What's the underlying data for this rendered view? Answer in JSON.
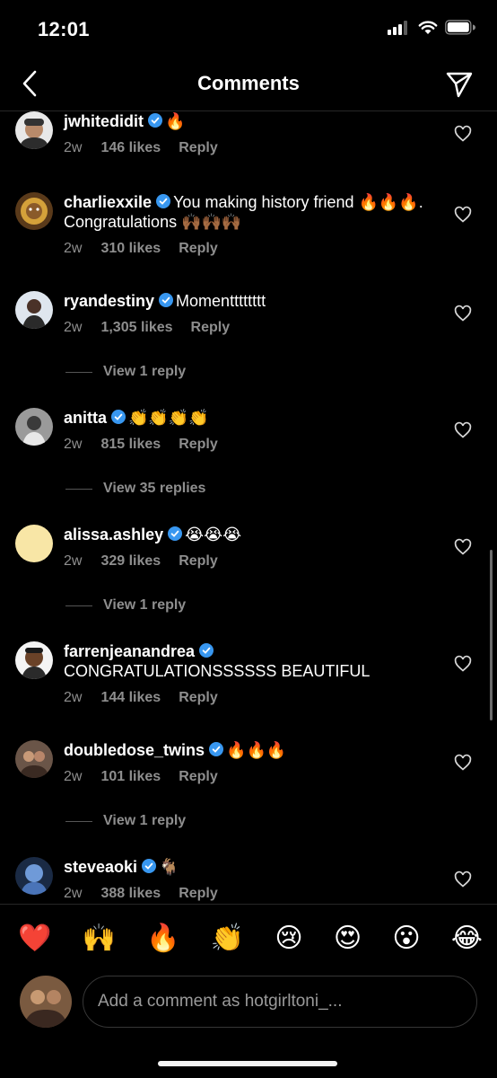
{
  "status": {
    "time": "12:01"
  },
  "nav": {
    "title": "Comments",
    "back_icon": "chevron-left-icon",
    "share_icon": "paper-plane-icon"
  },
  "comments": [
    {
      "username": "jwhitedidit",
      "verified": true,
      "text": "🔥",
      "time": "2w",
      "likes": "146 likes",
      "reply": "Reply"
    },
    {
      "username": "charliexxile",
      "verified": true,
      "text": "You making history friend 🔥🔥🔥. Congratulations 🙌🏾🙌🏾🙌🏾",
      "time": "2w",
      "likes": "310 likes",
      "reply": "Reply"
    },
    {
      "username": "ryandestiny",
      "verified": true,
      "text": "Momentttttttt",
      "time": "2w",
      "likes": "1,305 likes",
      "reply": "Reply",
      "view_replies": "View 1 reply"
    },
    {
      "username": "anitta",
      "verified": true,
      "text": "👏👏👏👏",
      "time": "2w",
      "likes": "815 likes",
      "reply": "Reply",
      "view_replies": "View 35 replies"
    },
    {
      "username": "alissa.ashley",
      "verified": true,
      "text": "😭😭😭",
      "time": "2w",
      "likes": "329 likes",
      "reply": "Reply",
      "view_replies": "View 1 reply"
    },
    {
      "username": "farrenjeanandrea",
      "verified": true,
      "text": "CONGRATULATIONSSSSSS BEAUTIFUL",
      "time": "2w",
      "likes": "144 likes",
      "reply": "Reply"
    },
    {
      "username": "doubledose_twins",
      "verified": true,
      "text": "🔥🔥🔥",
      "time": "2w",
      "likes": "101 likes",
      "reply": "Reply",
      "view_replies": "View 1 reply"
    },
    {
      "username": "steveaoki",
      "verified": true,
      "text": "🐐",
      "time": "2w",
      "likes": "388 likes",
      "reply": "Reply"
    }
  ],
  "reactions": [
    "❤️",
    "🙌",
    "🔥",
    "👏",
    "😢",
    "😍",
    "😮",
    "😂"
  ],
  "composer": {
    "placeholder": "Add a comment as hotgirltoni_..."
  },
  "colors": {
    "background": "#000000",
    "secondary_text": "#8e8e8e",
    "verified": "#3897f0"
  }
}
